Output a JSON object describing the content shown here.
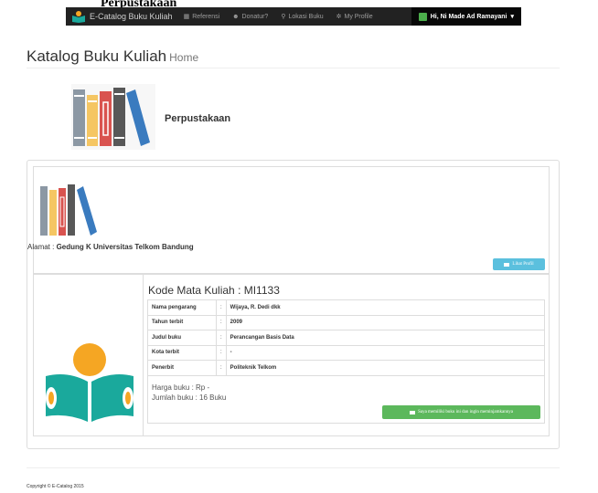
{
  "caption": "Perpustakaan",
  "navbar": {
    "brand": "E-Catalog Buku Kuliah",
    "items": [
      {
        "label": "Referensi",
        "icon": "list-icon"
      },
      {
        "label": "Donatur?",
        "icon": "users-icon"
      },
      {
        "label": "Lokasi Buku",
        "icon": "map-marker-icon"
      },
      {
        "label": "My Profile",
        "icon": "gear-icon"
      }
    ],
    "user": "Hi, Ni Made Ad Ramayani"
  },
  "page": {
    "title": "Katalog Buku Kuliah",
    "subtitle": "Home"
  },
  "library": {
    "name": "Perpustakaan",
    "address_label": "Alamat : ",
    "address": "Gedung K Universitas Telkom Bandung",
    "profile_button": "Lihat Profil"
  },
  "book": {
    "course": "Kode Mata Kuliah : MI1133",
    "details": [
      {
        "key": "Nama pengarang",
        "value": "Wijaya, R. Dedi dkk"
      },
      {
        "key": "Tahun terbit",
        "value": "2009"
      },
      {
        "key": "Judul buku",
        "value": "Perancangan Basis Data"
      },
      {
        "key": "Kota terbit",
        "value": "-"
      },
      {
        "key": "Penerbit",
        "value": "Politeknik Telkom"
      }
    ],
    "separator": ":",
    "price": "Harga buku : Rp -",
    "count": "Jumlah buku : 16 Buku",
    "login_button": "Saya memiliki buku ini dan ingin meminjamkannya"
  },
  "footer": {
    "copyright": "Copyright © E-Catalog 2015"
  },
  "colors": {
    "navbar": "#222222",
    "info_button": "#5bc0de",
    "success_button": "#5cb85c",
    "book_grey": "#8c98a4",
    "book_yellow": "#f5c663",
    "book_red": "#d9534f",
    "book_dark": "#585858",
    "book_blue": "#3a7bbf",
    "reader_teal": "#1aa99c",
    "reader_orange": "#f5a623"
  }
}
